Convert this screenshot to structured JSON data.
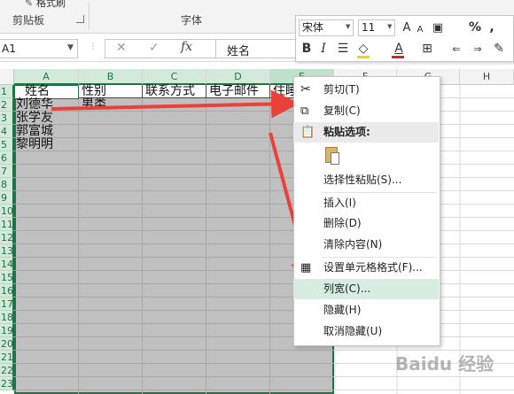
{
  "ribbon": {
    "clipboard_label": "剪贴板",
    "format_painter_label": "格式刷",
    "font_group_label": "字体"
  },
  "formula_bar": {
    "name_box": "A1",
    "value": "姓名"
  },
  "columns": [
    "A",
    "B",
    "C",
    "D",
    "E",
    "F",
    "G",
    "H"
  ],
  "rows": [
    "1",
    "2",
    "3",
    "4",
    "5",
    "6",
    "7",
    "8",
    "9",
    "10",
    "11",
    "12",
    "13",
    "14",
    "15",
    "16",
    "17",
    "18",
    "19",
    "20",
    "21",
    "22",
    "23"
  ],
  "header_cells": {
    "a1": "姓名",
    "b1": "性别",
    "c1": "联系方式",
    "d1": "电子邮件",
    "e1": "住睡"
  },
  "data_cells": {
    "a2": "刘德华",
    "b2": "男类",
    "a3": "张学友",
    "a4": "郭富城",
    "a5": "黎明明"
  },
  "mini_toolbar": {
    "font_name": "宋体",
    "font_size": "11",
    "bold": "B",
    "italic": "I",
    "increase_font": "A",
    "decrease_font": "A",
    "percent": "%",
    "comma": ","
  },
  "context_menu": {
    "cut": "剪切(T)",
    "copy": "复制(C)",
    "paste_options": "粘贴选项:",
    "paste_special": "选择性粘贴(S)...",
    "insert": "插入(I)",
    "delete": "删除(D)",
    "clear": "清除内容(N)",
    "format_cells": "设置单元格格式(F)...",
    "column_width": "列宽(C)...",
    "hide": "隐藏(H)",
    "unhide": "取消隐藏(U)"
  },
  "colors": {
    "selection_fill": "#c0c0c0",
    "excel_green": "#217346",
    "menu_highlight": "#d6eddf",
    "arrow_red": "#e8423a"
  },
  "watermark": "Baidu 经验"
}
